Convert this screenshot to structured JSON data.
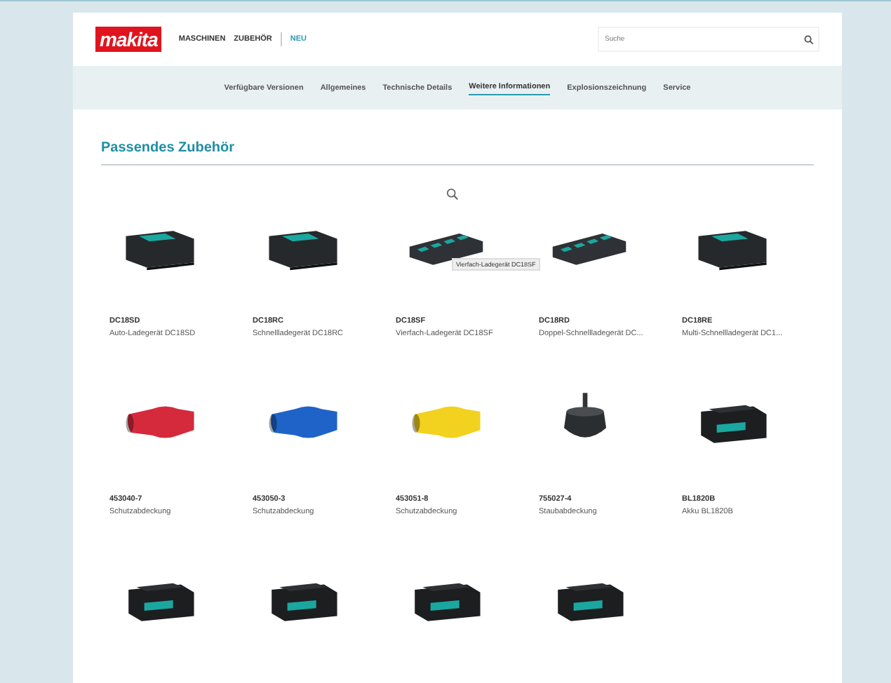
{
  "header": {
    "logo": "makita",
    "nav": [
      {
        "label": "MASCHINEN",
        "selected": false
      },
      {
        "label": "ZUBEHÖR",
        "selected": false
      },
      {
        "label": "NEU",
        "selected": true
      }
    ],
    "search": {
      "placeholder": "Suche"
    }
  },
  "subnav": [
    {
      "label": "Verfügbare Versionen",
      "selected": false
    },
    {
      "label": "Allgemeines",
      "selected": false
    },
    {
      "label": "Technische Details",
      "selected": false
    },
    {
      "label": "Weitere Informationen",
      "selected": true
    },
    {
      "label": "Explosionszeichnung",
      "selected": false
    },
    {
      "label": "Service",
      "selected": false
    }
  ],
  "section": {
    "title": "Passendes Zubehör"
  },
  "products": [
    {
      "kind": "charger",
      "code": "DC18SD",
      "name": "Auto-Ladegerät DC18SD"
    },
    {
      "kind": "charger",
      "code": "DC18RC",
      "name": "Schnellladegerät DC18RC"
    },
    {
      "kind": "multicharger",
      "code": "DC18SF",
      "name": "Vierfach-Ladegerät DC18SF",
      "tooltip": "Vierfach-Ladegerät DC18SF",
      "hovered": true
    },
    {
      "kind": "multicharger",
      "code": "DC18RD",
      "name": "Doppel-Schnellladegerät DC..."
    },
    {
      "kind": "charger",
      "code": "DC18RE",
      "name": "Multi-Schnellladegerät DC1..."
    },
    {
      "kind": "hose",
      "color": "#d42a3c",
      "code": "453040-7",
      "name": "Schutzabdeckung"
    },
    {
      "kind": "hose",
      "color": "#1f63c8",
      "code": "453050-3",
      "name": "Schutzabdeckung"
    },
    {
      "kind": "hose",
      "color": "#f2d21e",
      "code": "453051-8",
      "name": "Schutzabdeckung"
    },
    {
      "kind": "spindle",
      "code": "755027-4",
      "name": "Staubabdeckung"
    },
    {
      "kind": "battery",
      "code": "BL1820B",
      "name": "Akku BL1820B"
    },
    {
      "kind": "battery"
    },
    {
      "kind": "battery"
    },
    {
      "kind": "battery"
    },
    {
      "kind": "battery"
    }
  ]
}
